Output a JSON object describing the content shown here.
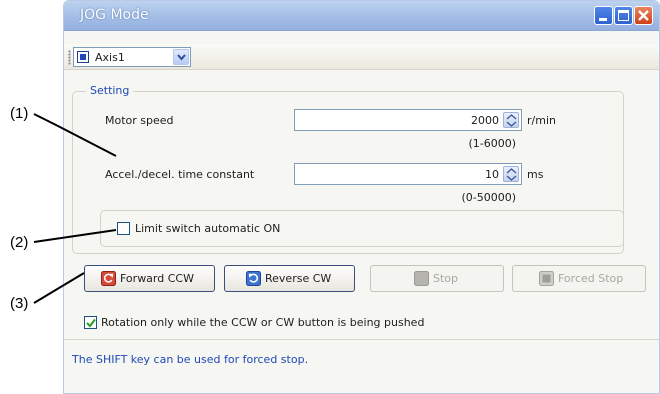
{
  "window": {
    "title": "JOG Mode"
  },
  "toolbar": {
    "axis_selected": "Axis1"
  },
  "setting": {
    "legend": "Setting",
    "motor_speed": {
      "label": "Motor speed",
      "value": "2000",
      "unit": "r/min",
      "range": "(1-6000)"
    },
    "accel": {
      "label": "Accel./decel. time constant",
      "value": "10",
      "unit": "ms",
      "range": "(0-50000)"
    },
    "limit_switch": {
      "label": "Limit switch automatic ON",
      "checked": false
    }
  },
  "buttons": {
    "forward": "Forward CCW",
    "reverse": "Reverse CW",
    "stop": "Stop",
    "forced_stop": "Forced Stop"
  },
  "rotation_only": {
    "label": "Rotation only while the CCW or CW button is being pushed",
    "checked": true
  },
  "hint": "The SHIFT key can be used for forced stop.",
  "callouts": {
    "c1": "(1)",
    "c2": "(2)",
    "c3": "(3)"
  },
  "icons": {
    "forward": "rotate-ccw-icon",
    "reverse": "rotate-cw-icon",
    "stop": "stop-icon",
    "forced_stop": "forced-stop-icon"
  },
  "colors": {
    "title_bar": "#a4bee6",
    "accent_text": "#1f49b6",
    "close_button": "#cf3f19"
  }
}
